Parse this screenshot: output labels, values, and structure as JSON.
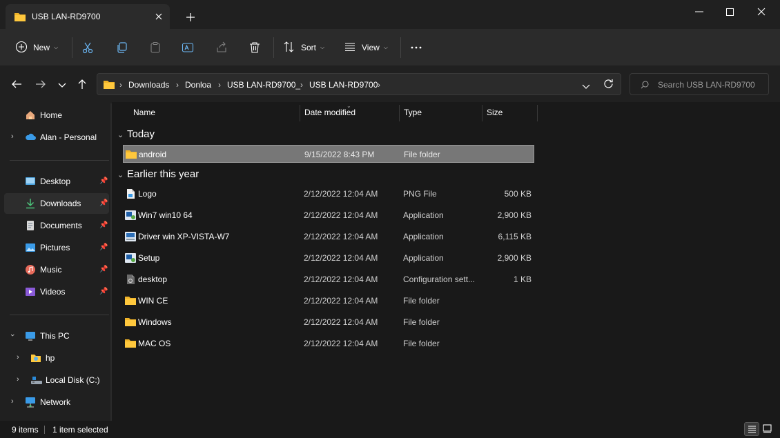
{
  "window": {
    "tab_title": "USB LAN-RD9700",
    "accent": "#0078d4"
  },
  "toolbar": {
    "new_label": "New",
    "sort_label": "Sort",
    "view_label": "View"
  },
  "address": {
    "crumbs": [
      "Downloads",
      "Donloa",
      "USB LAN-RD9700_",
      "USB LAN-RD9700"
    ],
    "search_placeholder": "Search USB LAN-RD9700"
  },
  "sidebar": {
    "items": [
      {
        "label": "Home",
        "icon": "home-icon"
      },
      {
        "label": "Alan - Personal",
        "icon": "cloud-icon"
      },
      {
        "label": "Desktop",
        "icon": "desktop-icon"
      },
      {
        "label": "Downloads",
        "icon": "download-icon"
      },
      {
        "label": "Documents",
        "icon": "document-icon"
      },
      {
        "label": "Pictures",
        "icon": "pictures-icon"
      },
      {
        "label": "Music",
        "icon": "music-icon"
      },
      {
        "label": "Videos",
        "icon": "videos-icon"
      },
      {
        "label": "This PC",
        "icon": "pc-icon"
      },
      {
        "label": "hp",
        "icon": "drive-folder-icon"
      },
      {
        "label": "Local Disk (C:)",
        "icon": "disk-icon"
      },
      {
        "label": "Network",
        "icon": "network-icon"
      }
    ]
  },
  "columns": {
    "name": "Name",
    "date": "Date modified",
    "type": "Type",
    "size": "Size"
  },
  "groups": {
    "today": "Today",
    "earlier": "Earlier this year"
  },
  "files": [
    {
      "name": "android",
      "date": "9/15/2022 8:43 PM",
      "type": "File folder",
      "size": "",
      "icon": "folder-icon"
    },
    {
      "name": "Logo",
      "date": "2/12/2022 12:04 AM",
      "type": "PNG File",
      "size": "500 KB",
      "icon": "image-file-icon"
    },
    {
      "name": "Win7 win10 64",
      "date": "2/12/2022 12:04 AM",
      "type": "Application",
      "size": "2,900 KB",
      "icon": "setup-app-icon"
    },
    {
      "name": "Driver win XP-VISTA-W7",
      "date": "2/12/2022 12:04 AM",
      "type": "Application",
      "size": "6,115 KB",
      "icon": "installer-app-icon"
    },
    {
      "name": "Setup",
      "date": "2/12/2022 12:04 AM",
      "type": "Application",
      "size": "2,900 KB",
      "icon": "setup-app-icon"
    },
    {
      "name": "desktop",
      "date": "2/12/2022 12:04 AM",
      "type": "Configuration sett...",
      "size": "1 KB",
      "icon": "config-file-icon"
    },
    {
      "name": "WIN CE",
      "date": "2/12/2022 12:04 AM",
      "type": "File folder",
      "size": "",
      "icon": "folder-icon"
    },
    {
      "name": "Windows",
      "date": "2/12/2022 12:04 AM",
      "type": "File folder",
      "size": "",
      "icon": "folder-icon"
    },
    {
      "name": "MAC OS",
      "date": "2/12/2022 12:04 AM",
      "type": "File folder",
      "size": "",
      "icon": "folder-icon"
    }
  ],
  "status": {
    "count": "9 items",
    "selected": "1 item selected"
  }
}
